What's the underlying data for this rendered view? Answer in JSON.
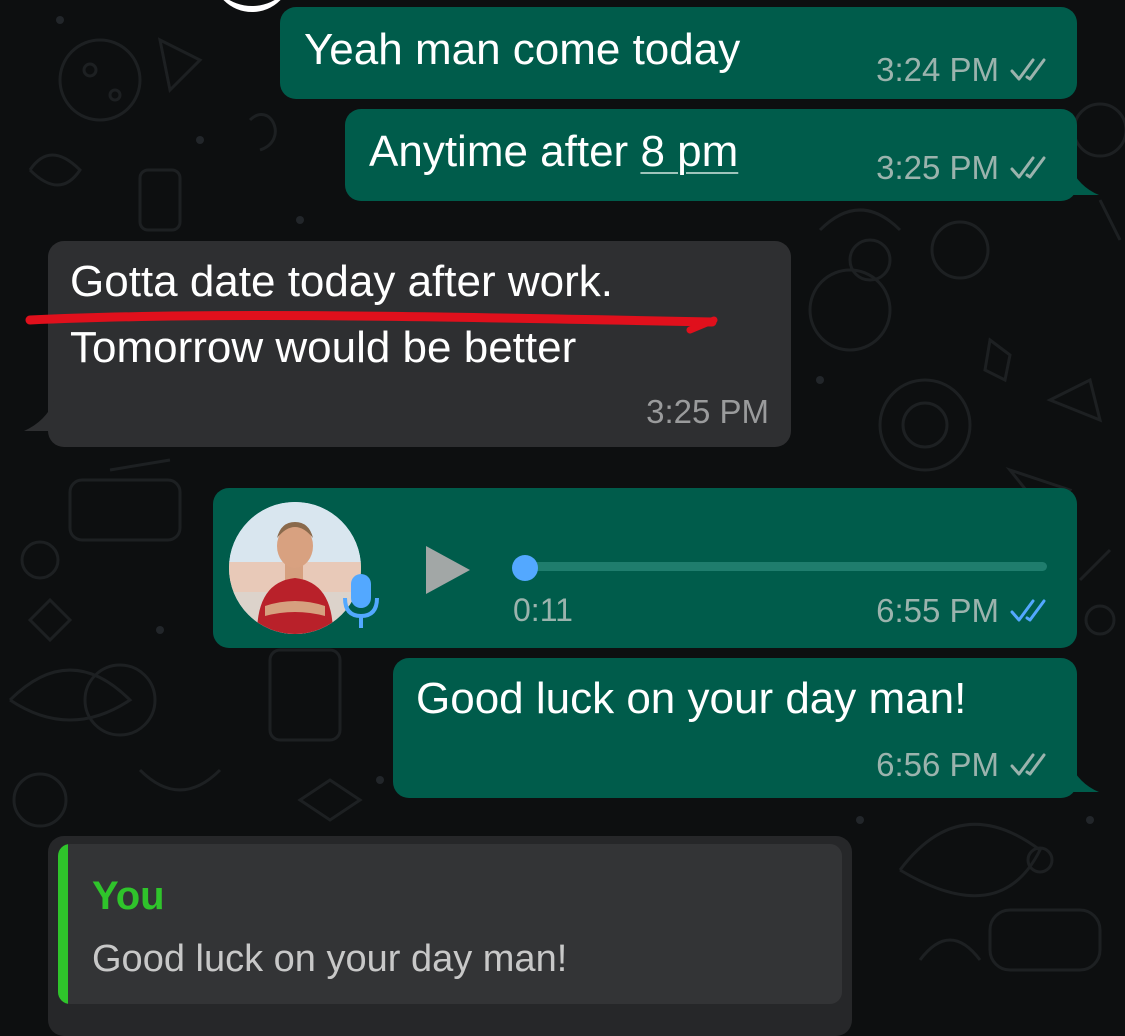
{
  "messages": [
    {
      "id": "m1",
      "direction": "outgoing",
      "text": "Yeah man come today",
      "time": "3:24 PM",
      "status": "delivered"
    },
    {
      "id": "m2",
      "direction": "outgoing",
      "text_before": "Anytime after ",
      "link_text": "8 pm",
      "time": "3:25 PM",
      "status": "delivered"
    },
    {
      "id": "m3",
      "direction": "incoming",
      "line1": "Gotta date today after work.",
      "line2": "Tomorrow would be better",
      "time": "3:25 PM",
      "annotation": "red underline"
    },
    {
      "id": "m4",
      "direction": "outgoing",
      "type": "voice",
      "duration": "0:11",
      "time": "6:55 PM",
      "status": "read",
      "progress": 0.0
    },
    {
      "id": "m5",
      "direction": "outgoing",
      "text": "Good luck on your day man!",
      "time": "6:56 PM",
      "status": "delivered"
    }
  ],
  "reply_preview": {
    "author": "You",
    "text": "Good luck on your day man!"
  },
  "colors": {
    "outgoing_bubble": "#005c4b",
    "incoming_bubble": "#2e2f31",
    "background": "#0d0f10",
    "read_ticks": "#53a8ff",
    "delivered_ticks": "#9bb3ad",
    "reply_accent": "#2fc42b",
    "annotation": "#e0101c"
  },
  "icons": {
    "ticks": "double-check-icon",
    "play": "play-icon",
    "mic": "microphone-icon"
  }
}
